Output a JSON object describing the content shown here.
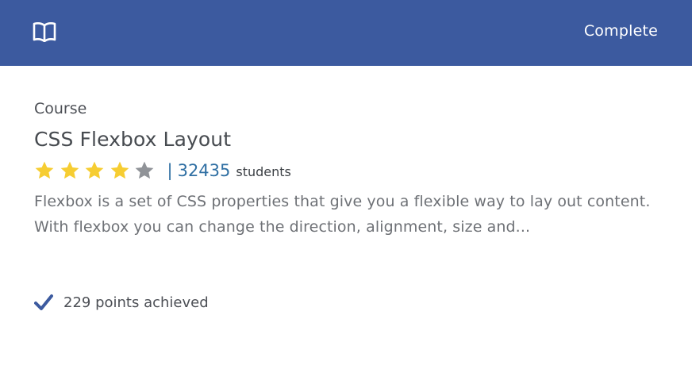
{
  "header": {
    "icon": "book-icon",
    "complete_label": "Complete",
    "bg_color": "#3c5a9f"
  },
  "course": {
    "kind": "Course",
    "title": "CSS Flexbox Layout",
    "rating": 4,
    "rating_max": 5,
    "separator": "|",
    "student_count": "32435",
    "student_label": "students",
    "description": "Flexbox is a set of CSS properties that give you a flexible way to lay out content. With flexbox you can change the direction, alignment, size and..."
  },
  "footer": {
    "icon": "checkmark-icon",
    "points_text": "229 points achieved"
  },
  "colors": {
    "star_filled": "#f6cd32",
    "star_empty": "#909398",
    "link": "#2f6fa3"
  }
}
